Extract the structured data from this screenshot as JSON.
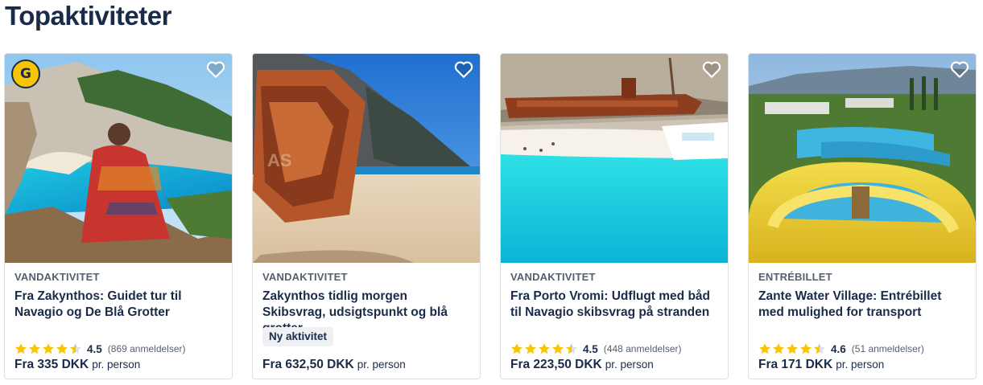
{
  "section_title": "Topaktiviteter",
  "colors": {
    "heading": "#1a2b49",
    "star": "#f7c600",
    "border": "#dcdfe4"
  },
  "cards": [
    {
      "category": "VANDAKTIVITET",
      "title": "Fra Zakynthos: Guidet tur til Navagio og De Blå Grotter",
      "rating": "4.5",
      "stars": 4.5,
      "reviews": "(869 anmeldelser)",
      "price": "Fra 335 DKK",
      "price_unit": "pr. person",
      "badge_icon": "getyourguide-badge-icon",
      "badge_text": "G"
    },
    {
      "category": "VANDAKTIVITET",
      "title": "Zakynthos tidlig morgen Skibsvrag, udsigtspunkt og blå grotter",
      "tag": "Ny aktivitet",
      "price": "Fra 632,50 DKK",
      "price_unit": "pr. person"
    },
    {
      "category": "VANDAKTIVITET",
      "title": "Fra Porto Vromi: Udflugt med båd til Navagio skibsvrag på stranden",
      "rating": "4.5",
      "stars": 4.5,
      "reviews": "(448 anmeldelser)",
      "price": "Fra 223,50 DKK",
      "price_unit": "pr. person"
    },
    {
      "category": "ENTRÉBILLET",
      "title": "Zante Water Village: Entrébillet med mulighed for transport",
      "rating": "4.6",
      "stars": 4.5,
      "reviews": "(51 anmeldelser)",
      "price": "Fra 171 DKK",
      "price_unit": "pr. person"
    }
  ]
}
